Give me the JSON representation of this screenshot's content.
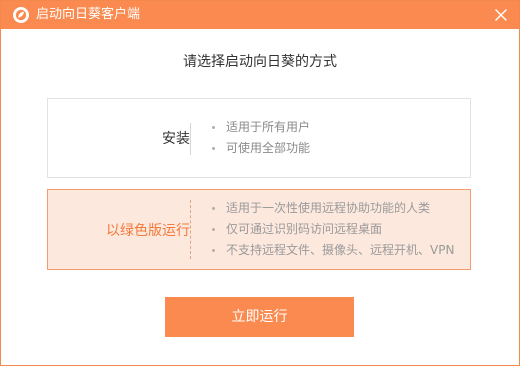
{
  "window": {
    "title": "启动向日葵客户端",
    "app_icon": "sunlogin-icon",
    "close_icon": "close-icon",
    "accent_color": "#fa8a50"
  },
  "main": {
    "heading": "请选择启动向日葵的方式",
    "options": [
      {
        "label": "安装",
        "selected": false,
        "bullets": [
          "适用于所有用户",
          "可使用全部功能"
        ]
      },
      {
        "label": "以绿色版运行",
        "selected": true,
        "bullets": [
          "适用于一次性使用远程协助功能的人类",
          "仅可通过识别码访问远程桌面",
          "不支持远程文件、摄像头、远程开机、VPN"
        ]
      }
    ],
    "run_button": "立即运行"
  }
}
